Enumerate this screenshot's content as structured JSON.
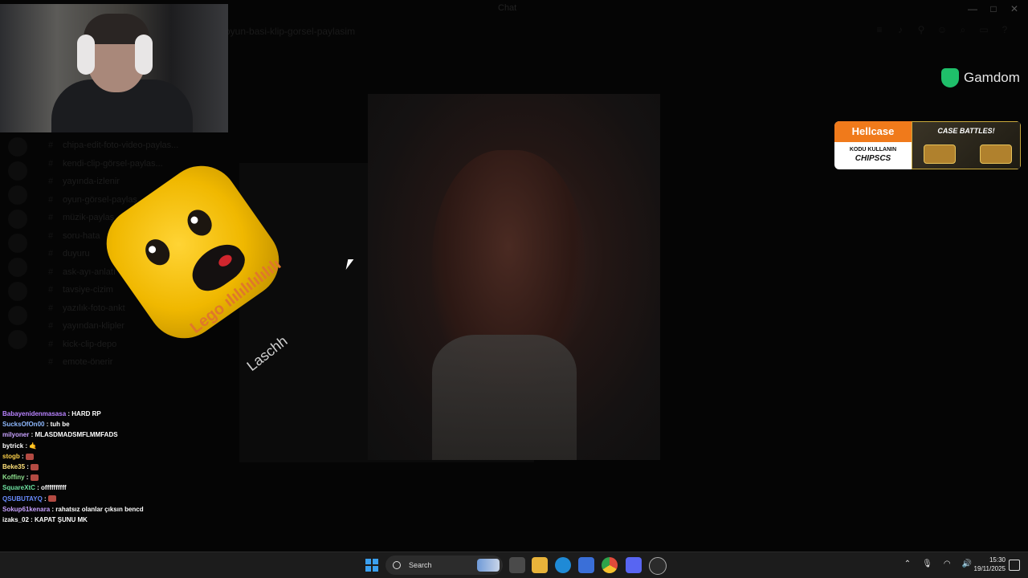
{
  "window": {
    "title": "Chat",
    "controls": [
      "—",
      "□",
      "✕"
    ]
  },
  "channel_header": {
    "name": "oyun-basi-klip-gorsel-paylasim"
  },
  "sidebar": {
    "channels": [
      "chipa-edit-foto-video-paylas...",
      "kendi-clip-görsel-paylas...",
      "yayında-izlenir",
      "oyun-görsel-paylaş",
      "müzik-paylaş",
      "soru-hata",
      "duyuru",
      "ask-ayı-anlatı",
      "tavsiye-cizim",
      "yazılık-foto-ankt",
      "yayından-klipler",
      "kick-clip-depo",
      "emote-önerir"
    ]
  },
  "overlays": {
    "lego_text": "Lego ılılılılılılılı",
    "lego_sub": "Laschh",
    "gamdom": "Gamdom",
    "hellcase": {
      "brand": "Hellcase",
      "code_label": "KODU KULLANIN",
      "code": "CHIPSCS",
      "promo": "CASE BATTLES!"
    }
  },
  "chat": [
    {
      "user": "Babayenidenmasasa",
      "color": "#b983ff",
      "text": "HARD RP"
    },
    {
      "user": "SucksOfOn00",
      "color": "#8fb9ff",
      "text": "tuh be"
    },
    {
      "user": "milyoner",
      "color": "#c8a2ff",
      "text": "MLASDMADSMFLMMFADS"
    },
    {
      "user": "bytrick",
      "color": "#ffffff",
      "text": "🤙"
    },
    {
      "user": "stogb",
      "color": "#ffd24a",
      "text": ""
    },
    {
      "user": "Beke35",
      "color": "#ffe27a",
      "text": ""
    },
    {
      "user": "Koffiny",
      "color": "#8fe28f",
      "text": ""
    },
    {
      "user": "SquareXtC",
      "color": "#6ee0a0",
      "text": "offffffffff"
    },
    {
      "user": "QSUBUTAYQ",
      "color": "#6a8cff",
      "text": ""
    },
    {
      "user": "Sokup61kenara",
      "color": "#c8a2ff",
      "text": "rahatsız olanlar çıksın bencd"
    },
    {
      "user": "izaks_02",
      "color": "#ffffff",
      "text": "KAPAT ŞUNU MK"
    }
  ],
  "taskbar": {
    "search_label": "Search",
    "time": "15:30",
    "date": "19/11/2025"
  },
  "colors": {
    "accent_hellcase": "#f07a1b",
    "gamdom_green": "#1fbf6a",
    "windows_blue": "#3ba0f0"
  }
}
